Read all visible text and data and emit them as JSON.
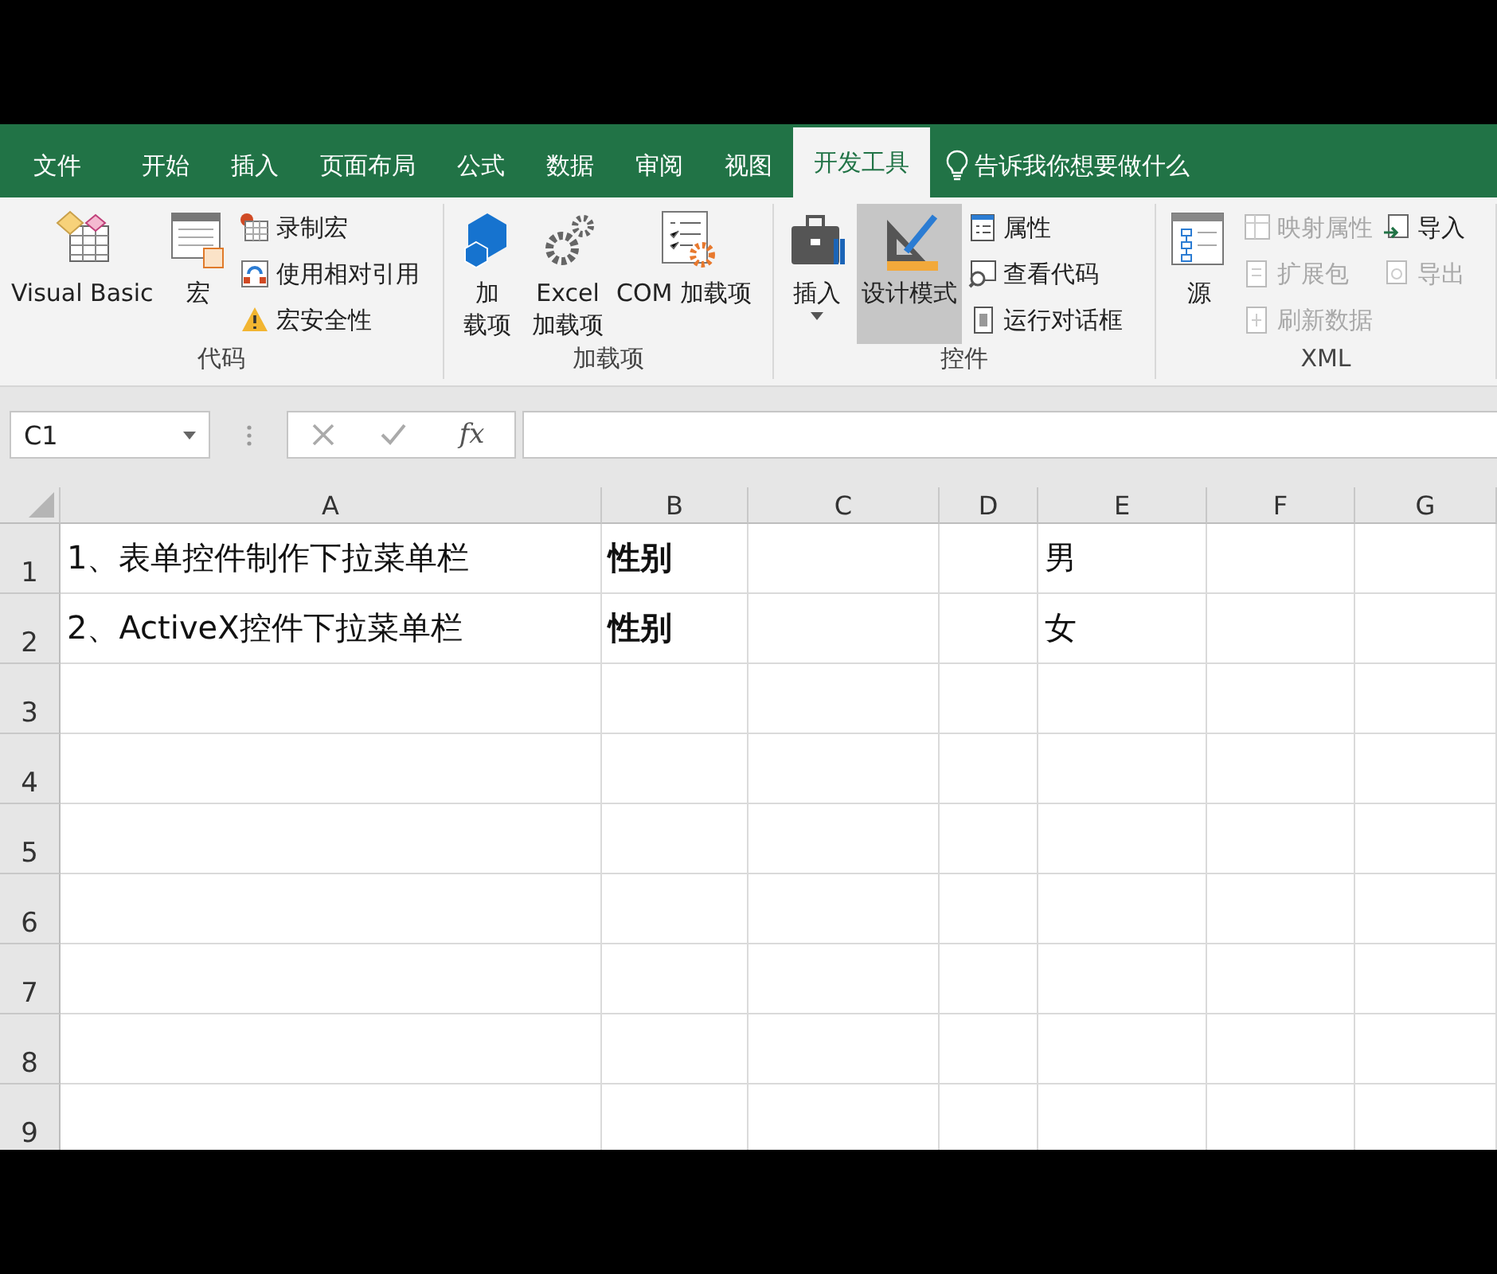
{
  "tabs": [
    {
      "label": "文件",
      "selected": false
    },
    {
      "label": "开始",
      "selected": false
    },
    {
      "label": "插入",
      "selected": false
    },
    {
      "label": "页面布局",
      "selected": false
    },
    {
      "label": "公式",
      "selected": false
    },
    {
      "label": "数据",
      "selected": false
    },
    {
      "label": "审阅",
      "selected": false
    },
    {
      "label": "视图",
      "selected": false
    },
    {
      "label": "开发工具",
      "selected": true
    }
  ],
  "tell_me": "告诉我你想要做什么",
  "ribbon": [
    {
      "label": "代码",
      "items": [
        {
          "kind": "large",
          "lines": [
            "Visual Basic"
          ],
          "selected": false,
          "dropdown": false
        },
        {
          "kind": "large",
          "lines": [
            "宏"
          ],
          "selected": false,
          "dropdown": false
        },
        {
          "kind": "stack",
          "entries": [
            {
              "label": "录制宏",
              "disabled": false
            },
            {
              "label": "使用相对引用",
              "disabled": false
            },
            {
              "label": "宏安全性",
              "disabled": false
            }
          ]
        }
      ]
    },
    {
      "label": "加载项",
      "items": [
        {
          "kind": "large",
          "lines": [
            "加",
            "载项"
          ],
          "selected": false,
          "dropdown": false
        },
        {
          "kind": "large",
          "lines": [
            "Excel",
            "加载项"
          ],
          "selected": false,
          "dropdown": false
        },
        {
          "kind": "large",
          "lines": [
            "COM 加载项"
          ],
          "selected": false,
          "dropdown": false
        }
      ]
    },
    {
      "label": "控件",
      "items": [
        {
          "kind": "large",
          "lines": [
            "插入"
          ],
          "selected": false,
          "dropdown": true
        },
        {
          "kind": "large",
          "lines": [
            "设计模式"
          ],
          "selected": true,
          "dropdown": false
        },
        {
          "kind": "stack",
          "entries": [
            {
              "label": "属性",
              "disabled": false
            },
            {
              "label": "查看代码",
              "disabled": false
            },
            {
              "label": "运行对话框",
              "disabled": false
            }
          ]
        }
      ]
    },
    {
      "label": "XML",
      "items": [
        {
          "kind": "large",
          "lines": [
            "源"
          ],
          "selected": false,
          "dropdown": false
        },
        {
          "kind": "stack",
          "entries": [
            {
              "label": "映射属性",
              "disabled": true
            },
            {
              "label": "扩展包",
              "disabled": true
            },
            {
              "label": "刷新数据",
              "disabled": true
            }
          ]
        },
        {
          "kind": "stack",
          "entries": [
            {
              "label": "导入",
              "disabled": false
            },
            {
              "label": "导出",
              "disabled": true
            }
          ]
        }
      ]
    }
  ],
  "name_box": "C1",
  "function_button": "fx",
  "columns": [
    "A",
    "B",
    "C",
    "D",
    "E",
    "F",
    "G"
  ],
  "rows": [
    {
      "number": "1",
      "cells": [
        {
          "text": "1、表单控件制作下拉菜单栏",
          "bold": false
        },
        {
          "text": "性别",
          "bold": true
        },
        null,
        null,
        {
          "text": "男",
          "bold": false
        },
        null,
        null
      ]
    },
    {
      "number": "2",
      "cells": [
        {
          "text": "2、ActiveX控件下拉菜单栏",
          "bold": false
        },
        {
          "text": "性别",
          "bold": true
        },
        null,
        null,
        {
          "text": "女",
          "bold": false
        },
        null,
        null
      ]
    },
    {
      "number": "3"
    },
    {
      "number": "4"
    },
    {
      "number": "5"
    },
    {
      "number": "6"
    },
    {
      "number": "7"
    },
    {
      "number": "8"
    },
    {
      "number": "9"
    }
  ]
}
